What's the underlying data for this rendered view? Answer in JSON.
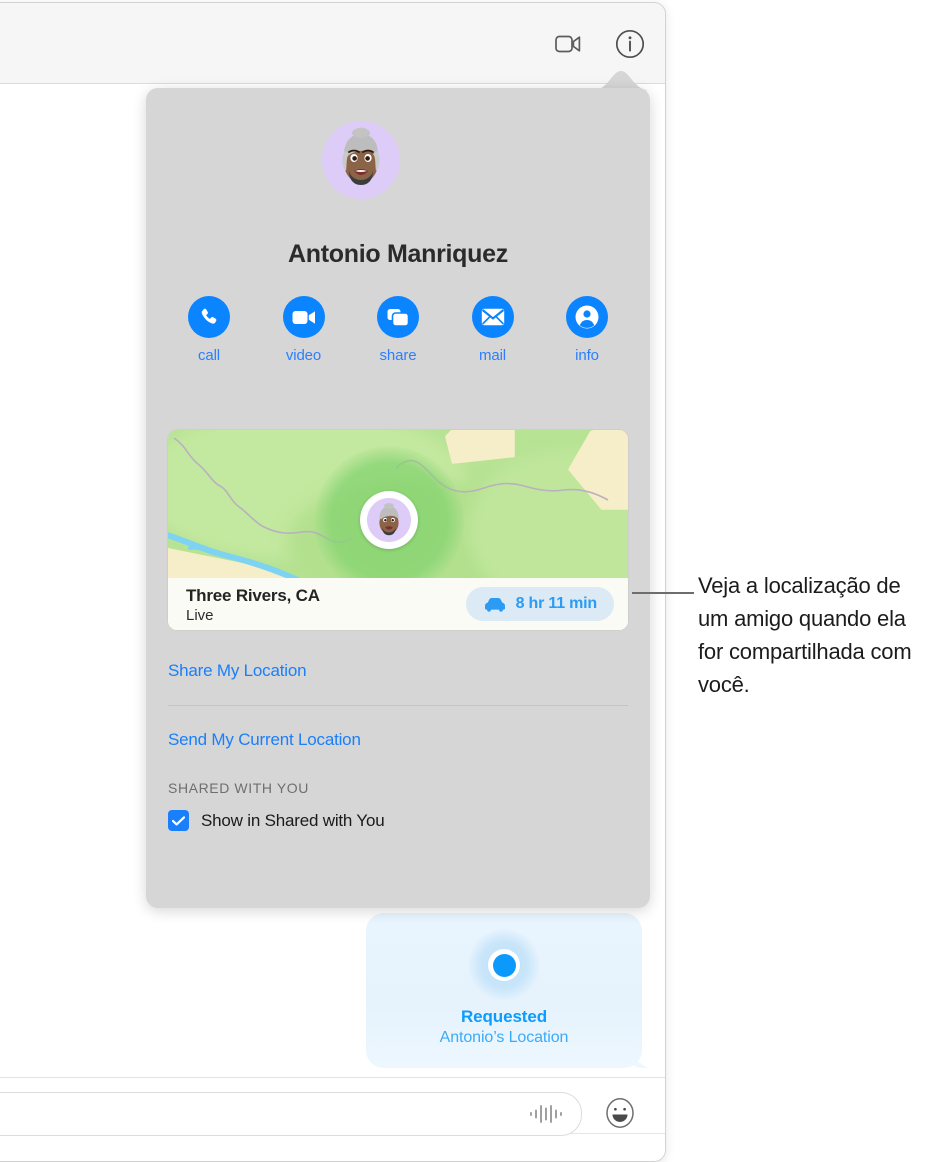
{
  "window": {
    "toolbar": {
      "buttons": [
        {
          "name": "facetime-video-button",
          "icon": "video-camera-icon"
        },
        {
          "name": "details-info-button",
          "icon": "info-circle-icon"
        }
      ]
    },
    "conversation": {
      "bubble": {
        "icon": "location-pin-icon",
        "title": "Requested",
        "subtitle": "Antonio’s Location"
      }
    },
    "input_bar": {
      "message_placeholder": "",
      "message_value": "",
      "audio_icon": "audio-waveform-icon",
      "emoji_icon": "smiley-face-icon"
    }
  },
  "popover": {
    "avatar_icon": "memoji-avatar",
    "contact_name": "Antonio Manriquez",
    "actions": [
      {
        "label": "call",
        "icon": "phone-icon"
      },
      {
        "label": "video",
        "icon": "video-camera-icon"
      },
      {
        "label": "share",
        "icon": "screen-share-icon"
      },
      {
        "label": "mail",
        "icon": "envelope-icon"
      },
      {
        "label": "info",
        "icon": "contact-card-icon"
      }
    ],
    "map_card": {
      "place": "Three Rivers, CA",
      "status": "Live",
      "eta": "8 hr 11 min",
      "eta_icon": "car-icon",
      "pin_icon": "memoji-map-pin"
    },
    "links": [
      {
        "label": "Share My Location"
      },
      {
        "label": "Send My Current Location"
      }
    ],
    "shared_section": {
      "label": "SHARED WITH YOU",
      "checkbox_label": "Show in Shared with You",
      "checkbox_checked": true
    }
  },
  "callout": {
    "text": "Veja a localização de um amigo quando ela for compartilhada com você."
  },
  "colors": {
    "accent_blue": "#0a84ff",
    "link_blue": "#1a7ffb",
    "bubble_blue": "#0c9cfd",
    "popover_bg": "#d6d6d6",
    "map_green": "#b7e394",
    "map_tan": "#f6eec8",
    "map_water": "#7fd3f2"
  }
}
